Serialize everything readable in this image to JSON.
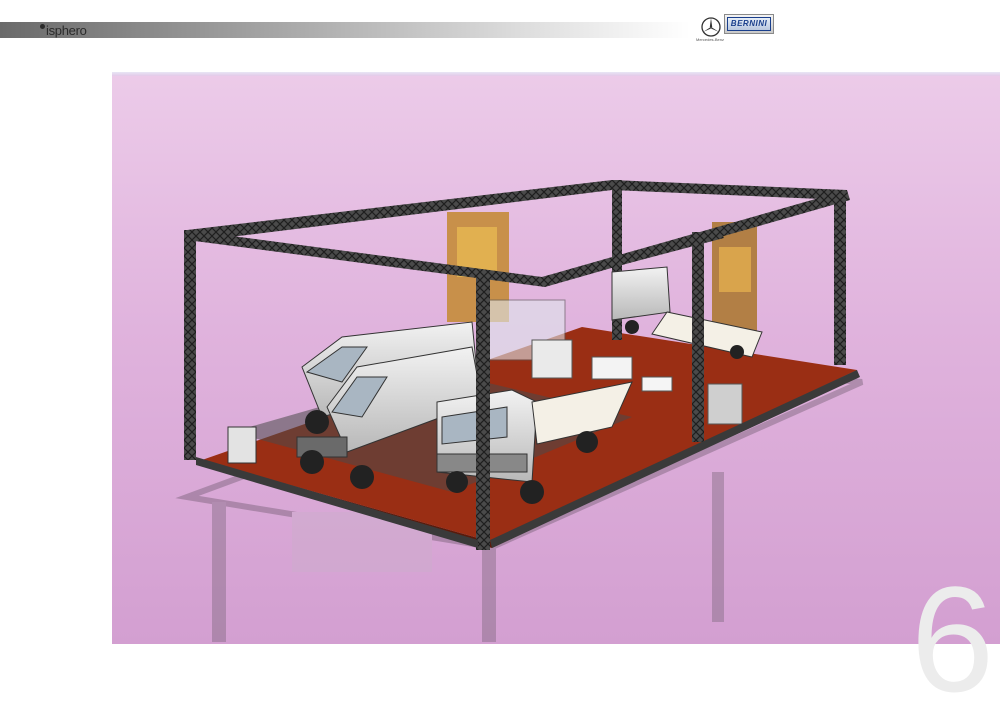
{
  "header": {
    "brand_name": "isphero",
    "partner_logos": [
      "Mercedes-Benz",
      "BERNINI"
    ],
    "mercedes_caption": "Mercedes-Benz",
    "bernini_label": "BERNINI"
  },
  "main": {
    "image_description_icon": "exhibition-stand-render"
  },
  "footer": {
    "page_number": "6"
  },
  "colors": {
    "header_gradient_start": "#6a6a6a",
    "panel_background": "#e0b3dd",
    "floor_red": "#9a2e14",
    "truss_dark": "#3a3a3a",
    "page_number": "#ececec"
  }
}
